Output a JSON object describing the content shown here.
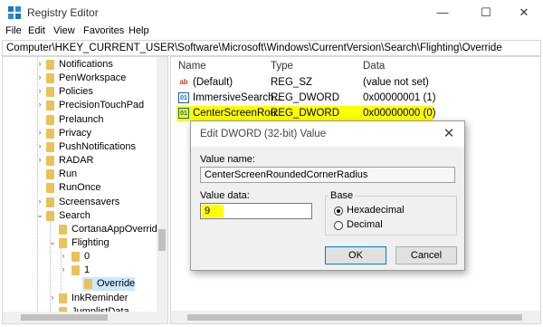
{
  "window": {
    "title": "Registry Editor",
    "minimize": "—",
    "maximize": "☐",
    "close": "✕"
  },
  "menu": [
    "File",
    "Edit",
    "View",
    "Favorites",
    "Help"
  ],
  "address": "Computer\\HKEY_CURRENT_USER\\Software\\Microsoft\\Windows\\CurrentVersion\\Search\\Flighting\\Override",
  "tree": {
    "items": [
      {
        "label": "Notifications",
        "arrow": "›",
        "expanded": false
      },
      {
        "label": "PenWorkspace",
        "arrow": "›",
        "expanded": false
      },
      {
        "label": "Policies",
        "arrow": "›",
        "expanded": false
      },
      {
        "label": "PrecisionTouchPad",
        "arrow": "›",
        "expanded": false
      },
      {
        "label": "Prelaunch",
        "arrow": "",
        "expanded": false
      },
      {
        "label": "Privacy",
        "arrow": "›",
        "expanded": false
      },
      {
        "label": "PushNotifications",
        "arrow": "›",
        "expanded": false
      },
      {
        "label": "RADAR",
        "arrow": "›",
        "expanded": false
      },
      {
        "label": "Run",
        "arrow": "",
        "expanded": false
      },
      {
        "label": "RunOnce",
        "arrow": "",
        "expanded": false
      },
      {
        "label": "Screensavers",
        "arrow": "›",
        "expanded": false
      },
      {
        "label": "Search",
        "arrow": "⌄",
        "expanded": true
      },
      {
        "label": "CortanaAppOverride",
        "arrow": "",
        "expanded": false
      },
      {
        "label": "Flighting",
        "arrow": "⌄",
        "expanded": true
      },
      {
        "label": "0",
        "arrow": "›",
        "expanded": false
      },
      {
        "label": "1",
        "arrow": "›",
        "expanded": false
      },
      {
        "label": "Override",
        "arrow": "",
        "expanded": false,
        "selected": true
      },
      {
        "label": "InkReminder",
        "arrow": "›",
        "expanded": false
      },
      {
        "label": "JumplistData",
        "arrow": "",
        "expanded": false
      }
    ]
  },
  "list": {
    "columns": [
      "Name",
      "Type",
      "Data"
    ],
    "rows": [
      {
        "icon": "ab",
        "name": "(Default)",
        "type": "REG_SZ",
        "data": "(value not set)",
        "highlight": false
      },
      {
        "icon": "01",
        "name": "ImmersiveSearch...",
        "type": "REG_DWORD",
        "data": "0x00000001 (1)",
        "highlight": false
      },
      {
        "icon": "01",
        "name": "CenterScreenRou...",
        "type": "REG_DWORD",
        "data": "0x00000000 (0)",
        "highlight": true
      }
    ]
  },
  "dialog": {
    "title": "Edit DWORD (32-bit) Value",
    "close": "✕",
    "value_name_label": "Value name:",
    "value_name": "CenterScreenRoundedCornerRadius",
    "value_data_label": "Value data:",
    "value_data": "9",
    "base_label": "Base",
    "hex_label": "Hexadecimal",
    "dec_label": "Decimal",
    "selected_base": "Hexadecimal",
    "ok": "OK",
    "cancel": "Cancel"
  },
  "colors": {
    "highlight": "#ffff00",
    "selection": "#cce8ff",
    "folder": "#e8c25a",
    "accent": "#0078d7"
  }
}
